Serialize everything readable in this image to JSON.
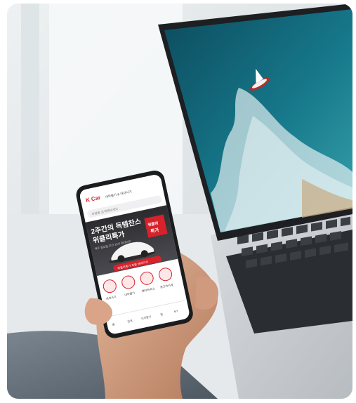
{
  "phone": {
    "logo": "K Car",
    "header_text": "내차팔기 & 내차사기",
    "search_placeholder": "차량을 검색해보세요",
    "banner_title_line1": "2주간의 득템찬스",
    "banner_title_line2": "위클리특가",
    "banner_subtitle": "매주 월요일 오전 10시 업데이트",
    "badge_line1": "위클리",
    "badge_line2": "특가",
    "cta_label": "위클리특가 차량 보러가기",
    "quick_menu": [
      "내차사기",
      "내차팔기",
      "렌터카/리스",
      "중고차시세"
    ],
    "bottom_nav": [
      "홈",
      "검색",
      "내차팔기",
      "찜",
      "MY"
    ],
    "accent_color": "#d7222b"
  }
}
